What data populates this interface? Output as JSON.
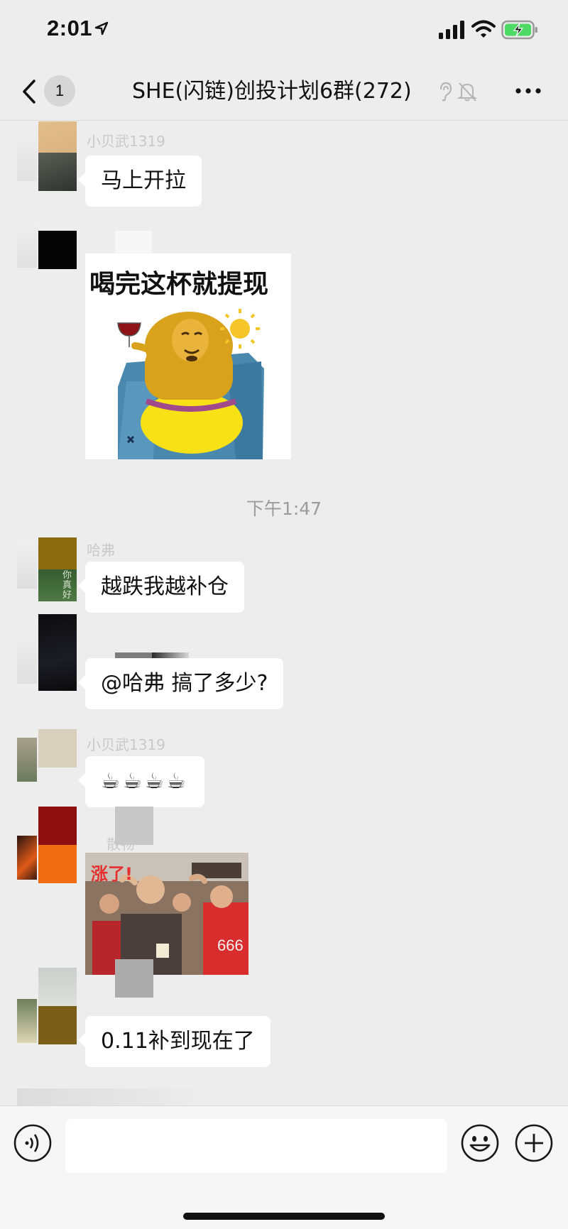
{
  "status_bar": {
    "time": "2:01"
  },
  "nav": {
    "unread_count": "1",
    "title": "SHE(闪链)创投计划6群(272)"
  },
  "messages": [
    {
      "sender": "小贝武1319",
      "text": "马上开拉"
    },
    {
      "sender": "",
      "sticker_caption": "喝完这杯就提现"
    },
    {
      "timestamp": "下午1:47"
    },
    {
      "sender": "哈弗",
      "text": "越跌我越补仓",
      "avatar_text": "你真好"
    },
    {
      "sender": "",
      "text": "@哈弗 搞了多少?"
    },
    {
      "sender": "小贝武1319",
      "text": "☕☕☕☕"
    },
    {
      "sender": "散物",
      "sticker_caption": "涨了!",
      "sticker_jersey": "666"
    },
    {
      "sender": "",
      "text": "0.11补到现在了"
    }
  ],
  "colors": {
    "background": "#ededed",
    "bubble": "#ffffff",
    "timestamp": "#9b9b9b",
    "sticker_red": "#e53030",
    "battery_green": "#4cd964"
  },
  "icons": [
    "location-arrow-icon",
    "signal-icon",
    "wifi-icon",
    "battery-charging-icon",
    "back-chevron-icon",
    "ear-icon",
    "bell-off-icon",
    "more-dots-icon",
    "voice-icon",
    "emoji-icon",
    "plus-icon"
  ]
}
